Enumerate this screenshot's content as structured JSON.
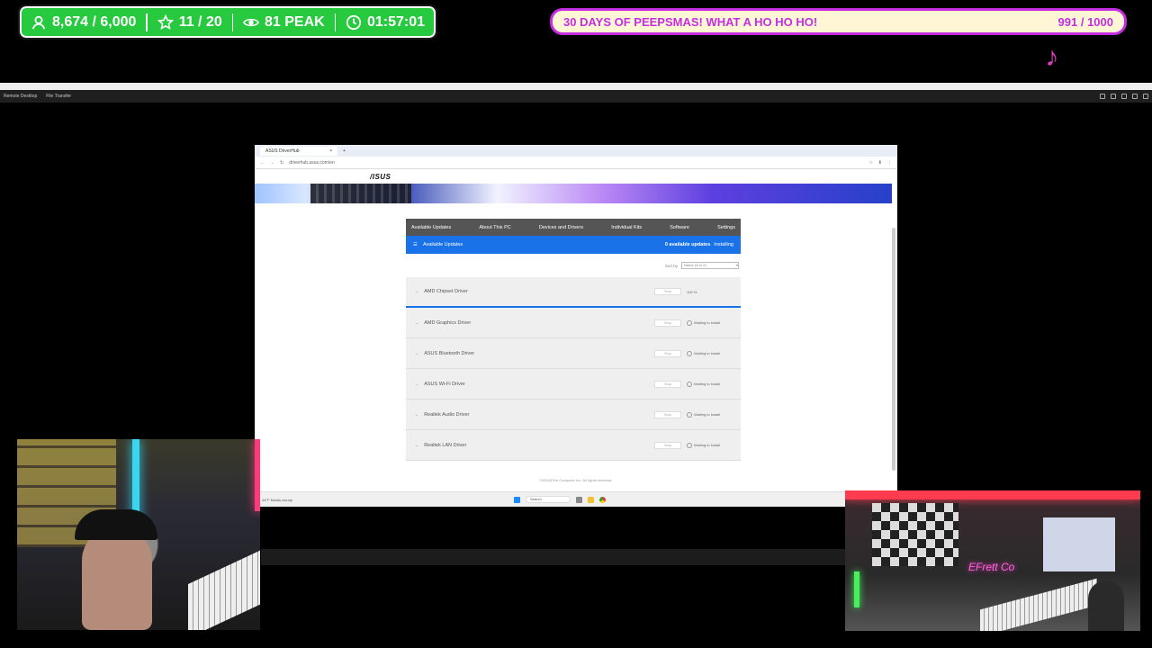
{
  "overlay": {
    "stats": [
      {
        "icon": "user-icon",
        "value": "8,674 / 6,000"
      },
      {
        "icon": "star-icon",
        "value": "11 / 20"
      },
      {
        "icon": "eye-icon",
        "value": "81 PEAK"
      },
      {
        "icon": "clock-icon",
        "value": "01:57:01"
      }
    ],
    "goal_title": "30 DAYS OF PEEPSMAS! WHAT A HO HO HO!",
    "goal_progress": "991 / 1000",
    "tiktok_icon": "tiktok-icon"
  },
  "remote": {
    "menu": [
      "Remote Desktop",
      "File Transfer"
    ],
    "browser": {
      "tab_title": "ASUS DriverHub",
      "url": "driverhub.asus.com/en"
    },
    "brand": "/ISUS",
    "nav": [
      "Available Updates",
      "About This PC",
      "Devices and Drivers",
      "Individual Kits",
      "Software",
      "Settings"
    ],
    "section_title": "Available Updates",
    "update_count": "0 available updates",
    "update_state": "Installing",
    "sort_label": "Sort by",
    "sort_value": "Name (A to Z)",
    "drivers": [
      {
        "name": "AMD Chipset Driver",
        "button": "Stop",
        "status": "100 %"
      },
      {
        "name": "AMD Graphics Driver",
        "button": "Stop",
        "status": "Waiting to install"
      },
      {
        "name": "ASUS Bluetooth Driver",
        "button": "Stop",
        "status": "Waiting to install"
      },
      {
        "name": "ASUS Wi-Fi Driver",
        "button": "Stop",
        "status": "Waiting to install"
      },
      {
        "name": "Realtek Audio Driver",
        "button": "Stop",
        "status": "Waiting to install"
      },
      {
        "name": "Realtek LAN Driver",
        "button": "Stop",
        "status": "Waiting to install"
      }
    ],
    "footer": "©ASUSTeK Computer Inc. All rights reserved.",
    "taskbar": {
      "weather": "44°F Mostly cloudy",
      "search": "Search"
    }
  },
  "cam_right_sign": "EFrett Co"
}
